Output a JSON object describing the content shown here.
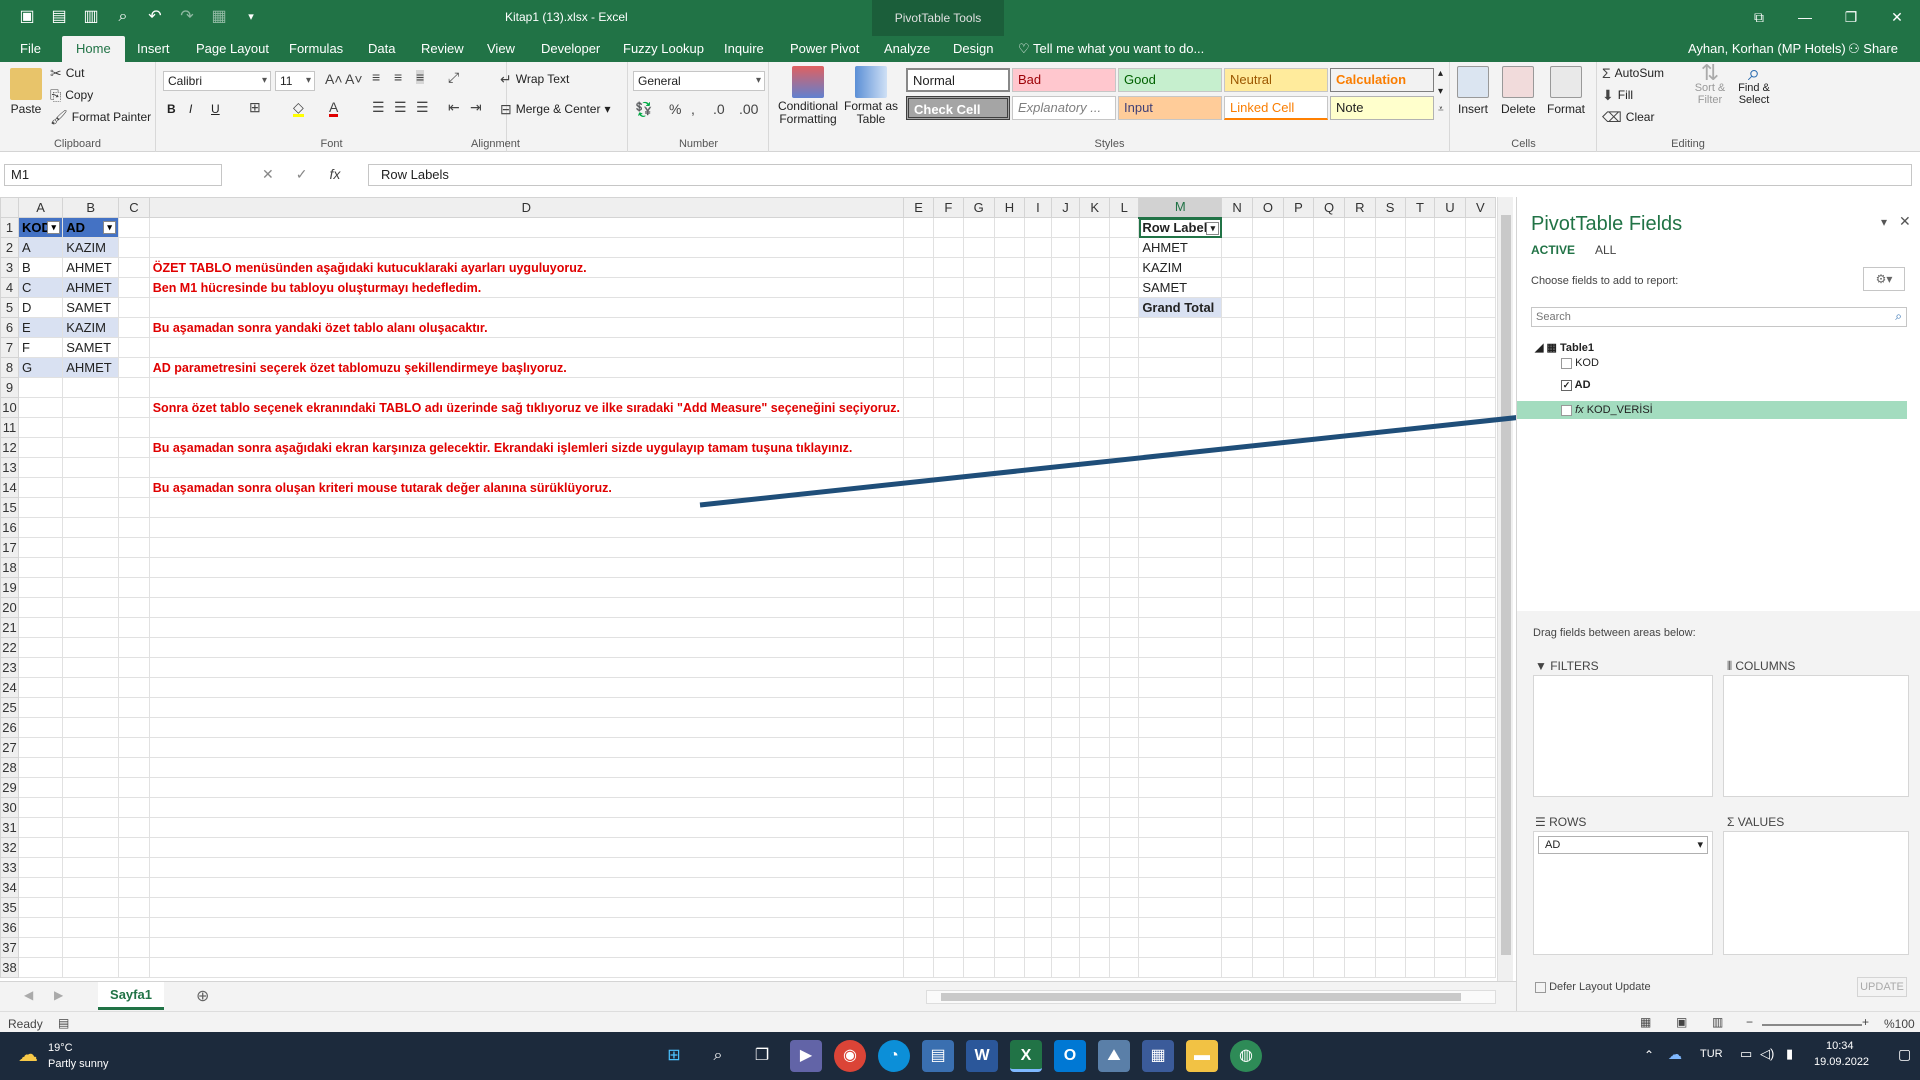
{
  "window": {
    "title": "Kitap1 (13).xlsx - Excel",
    "context_tab": "PivotTable Tools",
    "user": "Ayhan, Korhan (MP Hotels)",
    "share": "Share"
  },
  "tabs": [
    "File",
    "Home",
    "Insert",
    "Page Layout",
    "Formulas",
    "Data",
    "Review",
    "View",
    "Developer",
    "Fuzzy Lookup",
    "Inquire",
    "Power Pivot",
    "Analyze",
    "Design"
  ],
  "tell_me": "Tell me what you want to do...",
  "ribbon": {
    "clipboard": {
      "paste": "Paste",
      "cut": "Cut",
      "copy": "Copy",
      "format_painter": "Format Painter",
      "label": "Clipboard"
    },
    "font": {
      "name": "Calibri",
      "size": "11",
      "label": "Font"
    },
    "alignment": {
      "wrap": "Wrap Text",
      "merge": "Merge & Center",
      "label": "Alignment"
    },
    "number": {
      "format": "General",
      "label": "Number"
    },
    "styles": {
      "conditional": "Conditional Formatting",
      "format_as_table": "Format as Table",
      "cells": [
        "Normal",
        "Bad",
        "Good",
        "Neutral",
        "Calculation",
        "Check Cell",
        "Explanatory ...",
        "Input",
        "Linked Cell",
        "Note"
      ],
      "label": "Styles"
    },
    "cells": {
      "insert": "Insert",
      "delete": "Delete",
      "format": "Format",
      "label": "Cells"
    },
    "editing": {
      "autosum": "AutoSum",
      "fill": "Fill",
      "clear": "Clear",
      "sort": "Sort & Filter",
      "find": "Find & Select",
      "label": "Editing"
    }
  },
  "formula_bar": {
    "name_box": "M1",
    "fx": "fx",
    "content": "Row Labels"
  },
  "columns": [
    "A",
    "B",
    "C",
    "D",
    "E",
    "F",
    "G",
    "H",
    "I",
    "J",
    "K",
    "L",
    "M",
    "N",
    "O",
    "P",
    "Q",
    "R",
    "S",
    "T",
    "U",
    "V"
  ],
  "table": {
    "headers": [
      "KOD",
      "AD"
    ],
    "rows": [
      [
        "A",
        "KAZIM"
      ],
      [
        "B",
        "AHMET"
      ],
      [
        "C",
        "AHMET"
      ],
      [
        "D",
        "SAMET"
      ],
      [
        "E",
        "KAZIM"
      ],
      [
        "F",
        "SAMET"
      ],
      [
        "G",
        "AHMET"
      ]
    ]
  },
  "notes": {
    "r3": "ÖZET TABLO menüsünden aşağıdaki kutucuklaraki ayarları uyguluyoruz.",
    "r4": "Ben M1 hücresinde bu tabloyu oluşturmayı hedefledim.",
    "r6": "Bu aşamadan sonra yandaki özet tablo alanı oluşacaktır.",
    "r8": "AD parametresini seçerek özet tablomuzu şekillendirmeye başlıyoruz.",
    "r10": "Sonra özet tablo seçenek ekranındaki TABLO adı üzerinde sağ tıklıyoruz ve ilke sıradaki \"Add Measure\" seçeneğini seçiyoruz.",
    "r12": "Bu aşamadan sonra aşağıdaki ekran karşınıza gelecektir. Ekrandaki işlemleri sizde uygulayıp tamam tuşuna tıklayınız.",
    "r14": "Bu aşamadan sonra oluşan kriteri mouse tutarak değer alanına sürüklüyoruz."
  },
  "pivot": {
    "header": "Row Labels",
    "items": [
      "AHMET",
      "KAZIM",
      "SAMET"
    ],
    "total": "Grand Total"
  },
  "sheet_tabs": [
    "Sayfa1"
  ],
  "status": {
    "ready": "Ready",
    "zoom": "%100"
  },
  "pane": {
    "title": "PivotTable Fields",
    "tab_active": "ACTIVE",
    "tab_all": "ALL",
    "choose": "Choose fields to add to report:",
    "search_placeholder": "Search",
    "table": "Table1",
    "fields": [
      {
        "name": "KOD",
        "checked": false
      },
      {
        "name": "AD",
        "checked": true
      },
      {
        "name": "KOD_VERİSİ",
        "checked": false
      }
    ],
    "drag_label": "Drag fields between areas below:",
    "filters": "FILTERS",
    "columns": "COLUMNS",
    "rows": "ROWS",
    "values": "VALUES",
    "rows_field": "AD",
    "defer": "Defer Layout Update",
    "update": "UPDATE"
  },
  "taskbar": {
    "temp": "19°C",
    "weather": "Partly sunny",
    "lang": "TUR",
    "time": "10:34",
    "date": "19.09.2022"
  },
  "colors": {
    "excel_green": "#217346",
    "table_header": "#4472c4",
    "band": "#d9e1f2",
    "note_red": "#e00000",
    "arrow": "#1f4e79"
  }
}
